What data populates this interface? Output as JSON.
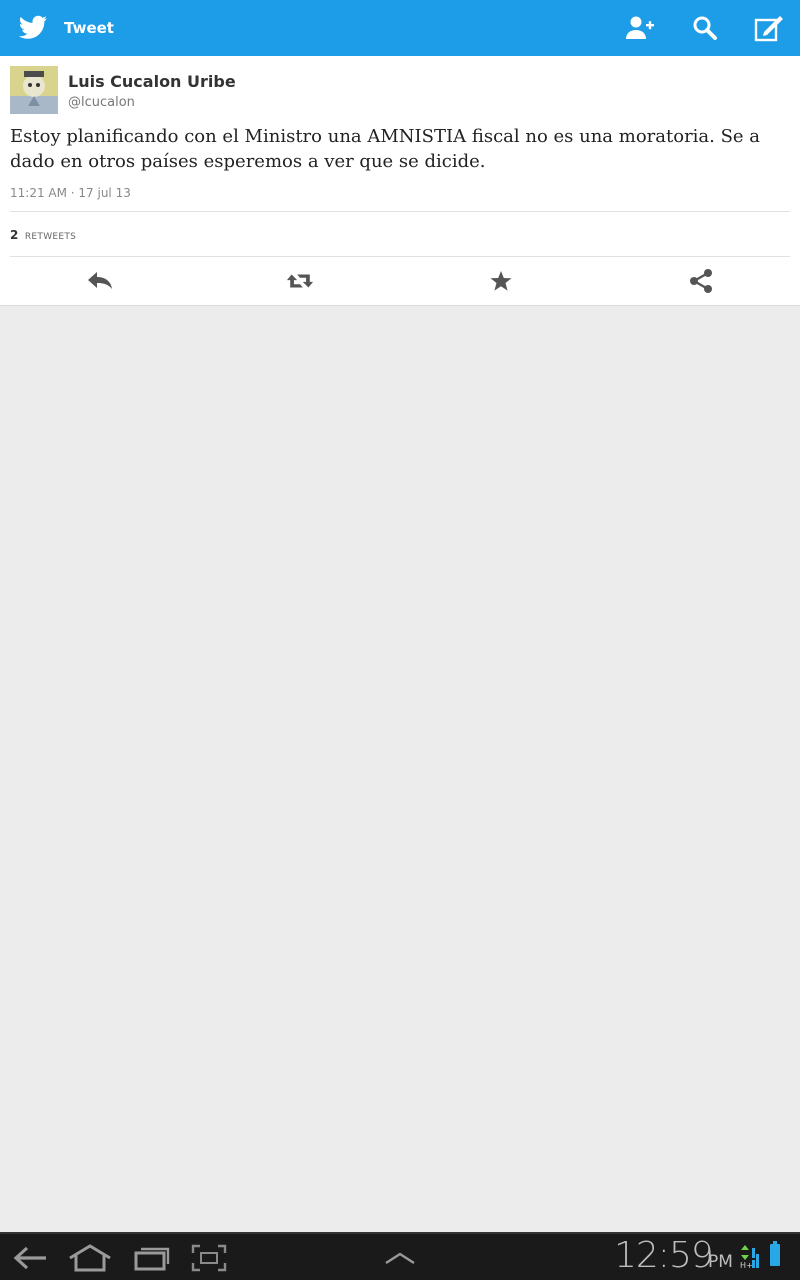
{
  "appbar": {
    "title": "Tweet",
    "accent": "#1d9de8",
    "actions": [
      "add-user-icon",
      "search-icon",
      "compose-icon"
    ]
  },
  "tweet": {
    "name": "Luis Cucalon Uribe",
    "handle": "@lcucalon",
    "text": "Estoy planificando con el Ministro una AMNISTIA fiscal no es una moratoria. Se a dado en otros países esperemos a ver que se dicide.",
    "timestamp": "11:21 AM · 17 jul 13",
    "retweet_count": "2",
    "retweet_label": "RETWEETS",
    "actions": [
      "reply-icon",
      "retweet-icon",
      "favorite-icon",
      "share-icon"
    ]
  },
  "system": {
    "time": "12:59",
    "ampm": "PM",
    "nav": [
      "back-icon",
      "home-icon",
      "recent-apps-icon",
      "screenshot-icon",
      "menu-up-icon"
    ]
  }
}
